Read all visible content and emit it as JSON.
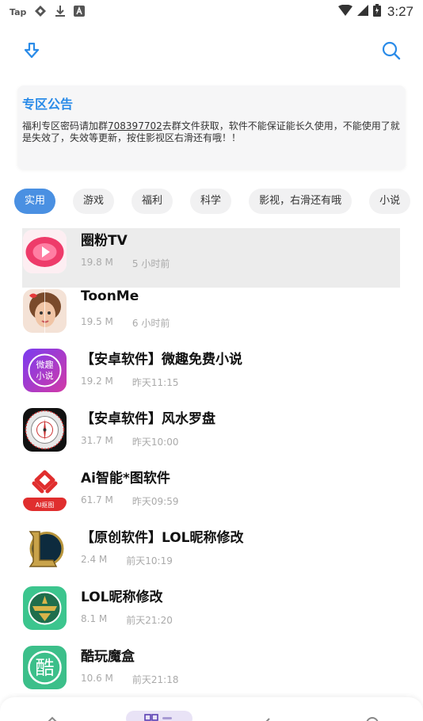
{
  "status_bar": {
    "tap_label": "Tap",
    "time": "3:27"
  },
  "notice": {
    "title": "专区公告",
    "text_before": "福利专区密码请加群",
    "qq_number": "708397702",
    "text_after": "去群文件获取，软件不能保证能长久使用，不能使用了就是失效了，失效等更新，按住影视区右滑还有哦！！"
  },
  "categories": [
    "实用",
    "游戏",
    "福利",
    "科学",
    "影视，右滑还有哦",
    "小说"
  ],
  "apps": [
    {
      "name": "圈粉TV",
      "size": "19.8 M",
      "time": "5 小时前"
    },
    {
      "name": "ToonMe",
      "size": "19.5 M",
      "time": "6 小时前"
    },
    {
      "name": "【安卓软件】微趣免费小说",
      "size": "19.2 M",
      "time": "昨天11:15"
    },
    {
      "name": "【安卓软件】风水罗盘",
      "size": "31.7 M",
      "time": "昨天10:00"
    },
    {
      "name": "Ai智能*图软件",
      "size": "61.7 M",
      "time": "昨天09:59"
    },
    {
      "name": "【原创软件】LOL昵称修改",
      "size": "2.4 M",
      "time": "前天10:19"
    },
    {
      "name": "LOL昵称修改",
      "size": "8.1 M",
      "time": "前天21:20"
    },
    {
      "name": "酷玩魔盒",
      "size": "10.6 M",
      "time": "前天21:18"
    }
  ],
  "icon_text": {
    "weiqu": [
      "微趣",
      "小说"
    ],
    "ai": "AI抠图",
    "ku": "酷"
  },
  "colors": {
    "accent": "#2a8be8",
    "chip_active": "#4a90e2"
  }
}
